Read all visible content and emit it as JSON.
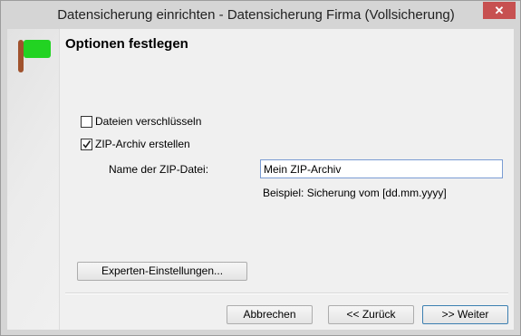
{
  "window": {
    "title": "Datensicherung einrichten - Datensicherung Firma (Vollsicherung)",
    "close_glyph": "✕"
  },
  "page": {
    "title": "Optionen festlegen"
  },
  "options": {
    "encrypt": {
      "label": "Dateien verschlüsseln",
      "checked": false
    },
    "zip": {
      "label": "ZIP-Archiv erstellen",
      "checked": true
    }
  },
  "zip_name": {
    "label": "Name der ZIP-Datei:",
    "value": "Mein ZIP-Archiv",
    "example": "Beispiel: Sicherung vom [dd.mm.yyyy]"
  },
  "buttons": {
    "expert": "Experten-Einstellungen...",
    "cancel": "Abbrechen",
    "back": "<< Zurück",
    "next": ">> Weiter"
  },
  "icons": {
    "flag": "flag-icon",
    "flag_color": "#22d322",
    "pole_color": "#a0522d"
  }
}
